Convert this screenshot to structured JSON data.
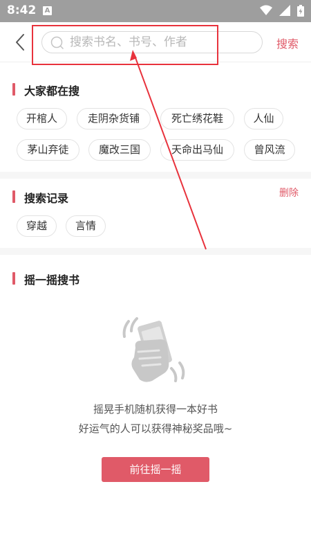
{
  "status_bar": {
    "time": "8:42",
    "app_icon_letter": "A"
  },
  "header": {
    "search_placeholder": "搜索书名、书号、作者",
    "search_value": "",
    "search_button": "搜索"
  },
  "hot_search": {
    "title": "大家都在搜",
    "tags": [
      "开棺人",
      "走阴杂货铺",
      "死亡绣花鞋",
      "人仙",
      "茅山弃徒",
      "魔改三国",
      "天命出马仙",
      "曾风流"
    ]
  },
  "history": {
    "title": "搜索记录",
    "delete_label": "删除",
    "tags": [
      "穿越",
      "言情"
    ]
  },
  "shake": {
    "title": "摇一摇搜书",
    "line1": "摇晃手机随机获得一本好书",
    "line2": "好运气的人可以获得神秘奖品哦~",
    "button": "前往摇一摇"
  },
  "colors": {
    "accent": "#e05a68",
    "annotation": "#e8323c",
    "status_bar": "#9e9e9e"
  }
}
